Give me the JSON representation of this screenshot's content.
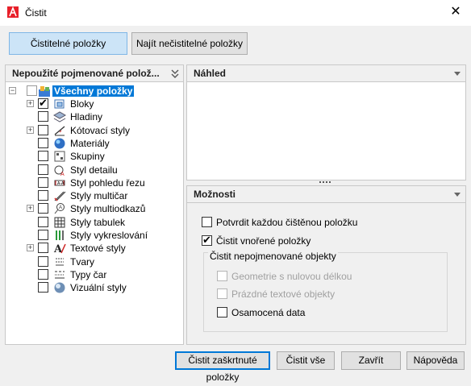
{
  "window": {
    "title": "Čistit",
    "close_glyph": "✕"
  },
  "tabs": [
    {
      "label": "Čistitelné položky",
      "active": true
    },
    {
      "label": "Najít nečistitelné položky",
      "active": false
    }
  ],
  "left_panel": {
    "header": "Nepoužité pojmenované polož..."
  },
  "tree": {
    "root": "Všechny položky",
    "items": [
      {
        "label": "Bloky",
        "expandable": true,
        "checked": true,
        "icon": "block-icon"
      },
      {
        "label": "Hladiny",
        "expandable": false,
        "checked": false,
        "icon": "layers-icon"
      },
      {
        "label": "Kótovací styly",
        "expandable": true,
        "checked": false,
        "icon": "dimension-style-icon"
      },
      {
        "label": "Materiály",
        "expandable": false,
        "checked": false,
        "icon": "material-icon"
      },
      {
        "label": "Skupiny",
        "expandable": false,
        "checked": false,
        "icon": "group-icon"
      },
      {
        "label": "Styl detailu",
        "expandable": false,
        "checked": false,
        "icon": "detail-style-icon"
      },
      {
        "label": "Styl pohledu řezu",
        "expandable": false,
        "checked": false,
        "icon": "section-view-icon"
      },
      {
        "label": "Styly multičar",
        "expandable": false,
        "checked": false,
        "icon": "multiline-style-icon"
      },
      {
        "label": "Styly multiodkazů",
        "expandable": true,
        "checked": false,
        "icon": "multileader-style-icon"
      },
      {
        "label": "Styly tabulek",
        "expandable": false,
        "checked": false,
        "icon": "table-style-icon"
      },
      {
        "label": "Styly vykreslování",
        "expandable": false,
        "checked": false,
        "icon": "plot-style-icon"
      },
      {
        "label": "Textové styly",
        "expandable": true,
        "checked": false,
        "icon": "text-style-icon"
      },
      {
        "label": "Tvary",
        "expandable": false,
        "checked": false,
        "icon": "shape-icon"
      },
      {
        "label": "Typy čar",
        "expandable": false,
        "checked": false,
        "icon": "linetype-icon"
      },
      {
        "label": "Vizuální styly",
        "expandable": false,
        "checked": false,
        "icon": "visual-style-icon"
      }
    ]
  },
  "preview_panel": {
    "header": "Náhled"
  },
  "options_panel": {
    "header": "Možnosti",
    "confirm": {
      "label": "Potvrdit každou čištěnou položku",
      "checked": false
    },
    "nested": {
      "label": "Čistit vnořené položky",
      "checked": true
    },
    "group_label": "Čistit nepojmenované objekty",
    "zero_length": {
      "label": "Geometrie s nulovou délkou",
      "checked": false,
      "disabled": true
    },
    "empty_text": {
      "label": "Prázdné textové objekty",
      "checked": false,
      "disabled": true
    },
    "orphaned": {
      "label": "Osamocená data",
      "checked": false,
      "disabled": false
    }
  },
  "buttons": {
    "purge_checked": "Čistit zaškrtnuté položky",
    "purge_all": "Čistit vše",
    "close": "Zavřít",
    "help": "Nápověda"
  },
  "colors": {
    "selection": "#0078d7",
    "active_tab": "#cce4f7",
    "app_icon": "#e8202a"
  }
}
